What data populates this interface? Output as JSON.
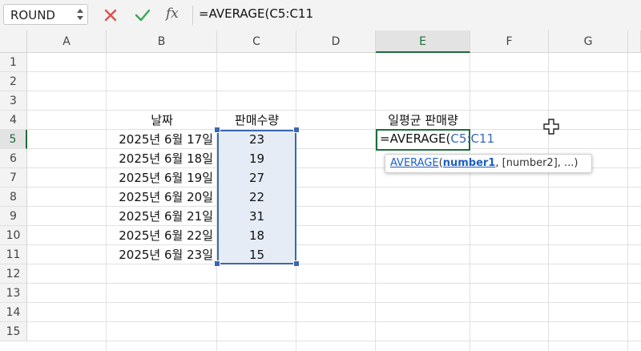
{
  "formula_bar": {
    "name_box": "ROUND",
    "cancel_icon": "x-icon",
    "confirm_icon": "checkmark-icon",
    "fx_label": "fx",
    "formula": "=AVERAGE(C5:C11"
  },
  "columns": [
    "A",
    "B",
    "C",
    "D",
    "E",
    "F",
    "G"
  ],
  "rows": [
    "1",
    "2",
    "3",
    "4",
    "5",
    "6",
    "7",
    "8",
    "9",
    "10",
    "11",
    "12",
    "13",
    "14",
    "15"
  ],
  "active_column": "E",
  "active_row": "5",
  "sheet": {
    "header_date": "날짜",
    "header_sales": "판매수량",
    "header_avg": "일평균 판매량",
    "dates": [
      "2025년 6월 17일",
      "2025년 6월 18일",
      "2025년 6월 19일",
      "2025년 6월 20일",
      "2025년 6월 21일",
      "2025년 6월 22일",
      "2025년 6월 23일"
    ],
    "sales": [
      "23",
      "19",
      "27",
      "22",
      "31",
      "18",
      "15"
    ],
    "edit_prefix": "=AVERAGE(",
    "edit_ref": "C5:C11"
  },
  "tooltip": {
    "function": "AVERAGE",
    "open_paren": "(",
    "arg1": "number1",
    "rest": ", [number2], ...)"
  },
  "colors": {
    "accent_green": "#1e6c3a",
    "selection_blue": "#3b67b0",
    "cancel_red": "#d9534f",
    "confirm_green": "#3aa655"
  }
}
